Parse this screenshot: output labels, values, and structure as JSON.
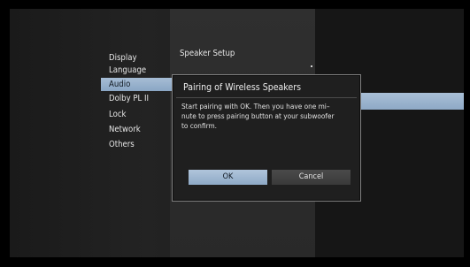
{
  "menu": {
    "items": [
      {
        "label": "Display"
      },
      {
        "label": "Language"
      },
      {
        "label": "Audio"
      },
      {
        "label": "Dolby PL II"
      },
      {
        "label": "Lock"
      },
      {
        "label": "Network"
      },
      {
        "label": "Others"
      }
    ],
    "selected": "Audio"
  },
  "settings": {
    "title": "Speaker Setup"
  },
  "dialog": {
    "title": "Pairing of Wireless Speakers",
    "message": "Start pairing with OK. Then you have one mi–\nnute to press pairing button at your subwoofer\nto confirm.",
    "ok_label": "OK",
    "cancel_label": "Cancel"
  },
  "colors": {
    "highlight": "#9bb4cf",
    "background": "#000000",
    "panel": "#2f2f2f"
  }
}
